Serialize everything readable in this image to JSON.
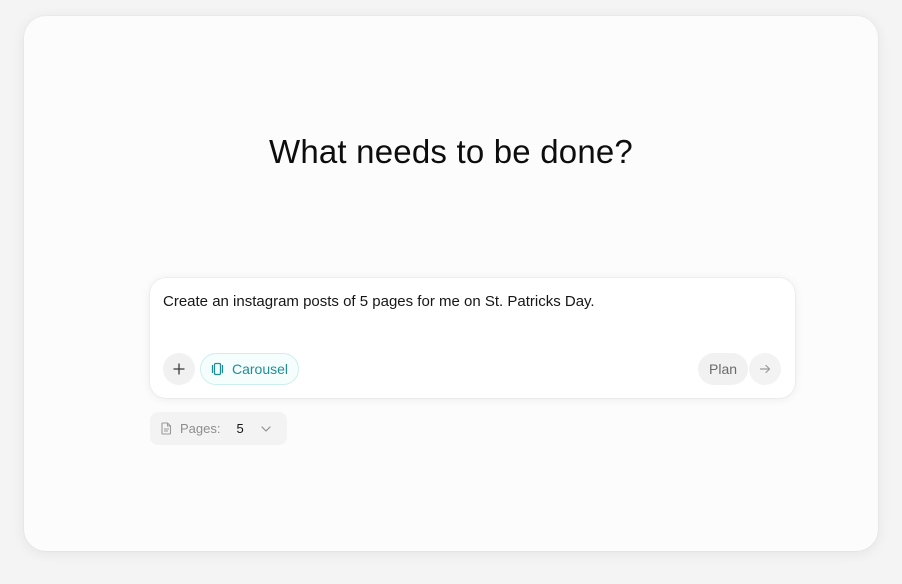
{
  "main": {
    "headline": "What needs to be done?"
  },
  "composer": {
    "prompt": "Create an instagram posts of 5 pages for me on St. Patricks Day.",
    "add_icon": "plus-icon",
    "chip": {
      "label": "Carousel",
      "icon": "carousel-icon",
      "color": "#1f8e96"
    },
    "plan_label": "Plan",
    "send_icon": "arrow-right-icon"
  },
  "pages": {
    "label": "Pages:",
    "value": "5",
    "icon": "document-icon",
    "dropdown_icon": "chevron-down-icon"
  }
}
